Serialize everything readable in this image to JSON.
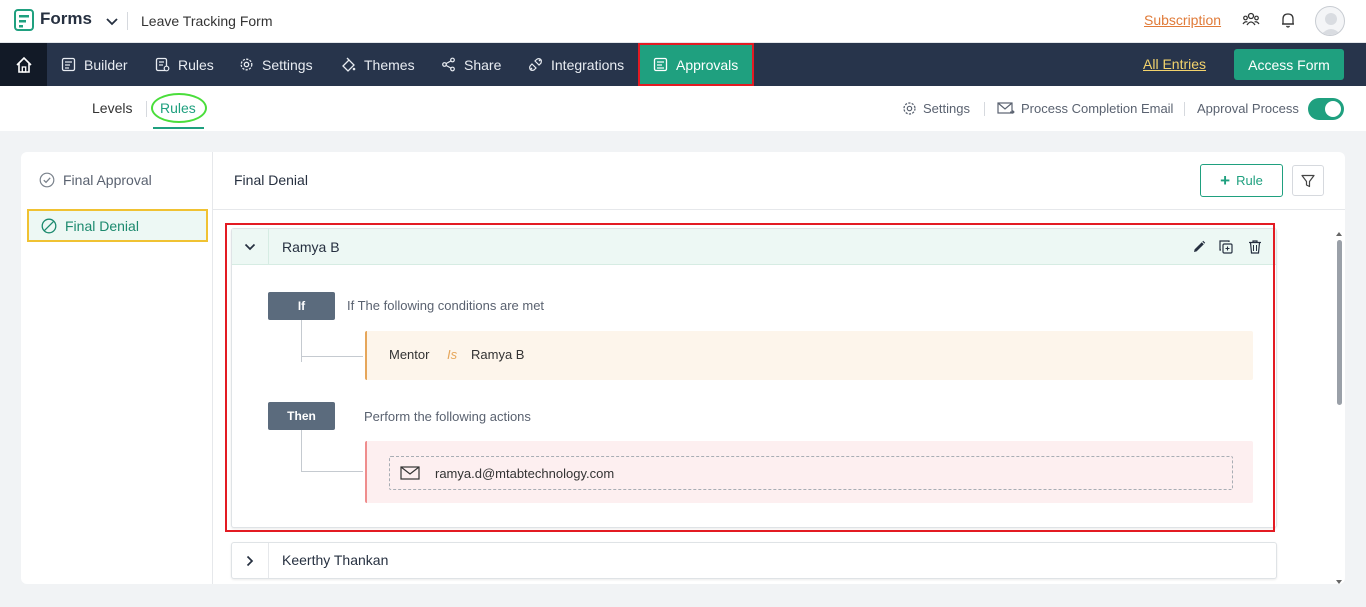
{
  "header": {
    "app_name": "Forms",
    "form_title": "Leave Tracking Form",
    "subscription": "Subscription"
  },
  "nav": {
    "items": [
      {
        "label": "Builder",
        "icon": "builder-icon"
      },
      {
        "label": "Rules",
        "icon": "rules-icon"
      },
      {
        "label": "Settings",
        "icon": "gear-icon"
      },
      {
        "label": "Themes",
        "icon": "themes-icon"
      },
      {
        "label": "Share",
        "icon": "share-icon"
      },
      {
        "label": "Integrations",
        "icon": "integrations-icon"
      },
      {
        "label": "Approvals",
        "icon": "approvals-icon",
        "active": true
      }
    ],
    "all_entries": "All Entries",
    "access_form": "Access Form"
  },
  "subnav": {
    "levels": "Levels",
    "rules": "Rules",
    "settings": "Settings",
    "process_completion_email": "Process Completion Email",
    "approval_process": "Approval Process",
    "approval_process_enabled": true
  },
  "sidebar": {
    "items": [
      {
        "label": "Final Approval",
        "icon": "check-circle-icon"
      },
      {
        "label": "Final Denial",
        "icon": "ban-icon",
        "active": true
      }
    ]
  },
  "content": {
    "title": "Final Denial",
    "add_rule": "Rule"
  },
  "rules": [
    {
      "name": "Ramya B",
      "expanded": true,
      "if_label": "If",
      "condition_caption": "If The following conditions are met",
      "condition": {
        "field": "Mentor",
        "operator": "Is",
        "value": "Ramya B"
      },
      "then_label": "Then",
      "action_caption": "Perform the following actions",
      "action_email": "ramya.d@mtabtechnology.com"
    },
    {
      "name": "Keerthy Thankan",
      "expanded": false
    }
  ],
  "colors": {
    "brand": "#1fa07f",
    "navbar": "#27344b",
    "highlight_red": "#e31b23",
    "highlight_yellow": "#f0c232",
    "highlight_green": "#4ade3b"
  }
}
